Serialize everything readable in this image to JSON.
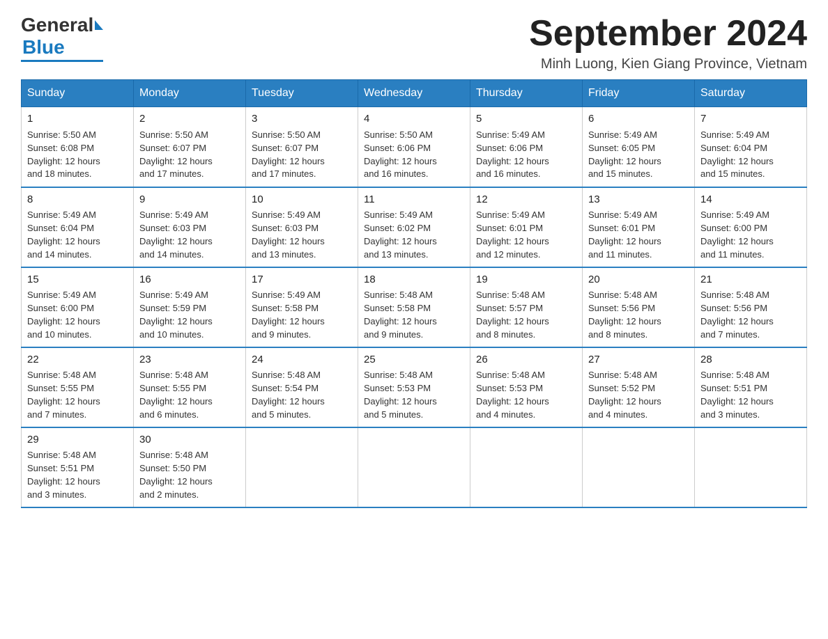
{
  "logo": {
    "general": "General",
    "blue": "Blue"
  },
  "title": {
    "month_year": "September 2024",
    "location": "Minh Luong, Kien Giang Province, Vietnam"
  },
  "days_of_week": [
    "Sunday",
    "Monday",
    "Tuesday",
    "Wednesday",
    "Thursday",
    "Friday",
    "Saturday"
  ],
  "weeks": [
    [
      {
        "day": "1",
        "sunrise": "5:50 AM",
        "sunset": "6:08 PM",
        "daylight": "12 hours and 18 minutes."
      },
      {
        "day": "2",
        "sunrise": "5:50 AM",
        "sunset": "6:07 PM",
        "daylight": "12 hours and 17 minutes."
      },
      {
        "day": "3",
        "sunrise": "5:50 AM",
        "sunset": "6:07 PM",
        "daylight": "12 hours and 17 minutes."
      },
      {
        "day": "4",
        "sunrise": "5:50 AM",
        "sunset": "6:06 PM",
        "daylight": "12 hours and 16 minutes."
      },
      {
        "day": "5",
        "sunrise": "5:49 AM",
        "sunset": "6:06 PM",
        "daylight": "12 hours and 16 minutes."
      },
      {
        "day": "6",
        "sunrise": "5:49 AM",
        "sunset": "6:05 PM",
        "daylight": "12 hours and 15 minutes."
      },
      {
        "day": "7",
        "sunrise": "5:49 AM",
        "sunset": "6:04 PM",
        "daylight": "12 hours and 15 minutes."
      }
    ],
    [
      {
        "day": "8",
        "sunrise": "5:49 AM",
        "sunset": "6:04 PM",
        "daylight": "12 hours and 14 minutes."
      },
      {
        "day": "9",
        "sunrise": "5:49 AM",
        "sunset": "6:03 PM",
        "daylight": "12 hours and 14 minutes."
      },
      {
        "day": "10",
        "sunrise": "5:49 AM",
        "sunset": "6:03 PM",
        "daylight": "12 hours and 13 minutes."
      },
      {
        "day": "11",
        "sunrise": "5:49 AM",
        "sunset": "6:02 PM",
        "daylight": "12 hours and 13 minutes."
      },
      {
        "day": "12",
        "sunrise": "5:49 AM",
        "sunset": "6:01 PM",
        "daylight": "12 hours and 12 minutes."
      },
      {
        "day": "13",
        "sunrise": "5:49 AM",
        "sunset": "6:01 PM",
        "daylight": "12 hours and 11 minutes."
      },
      {
        "day": "14",
        "sunrise": "5:49 AM",
        "sunset": "6:00 PM",
        "daylight": "12 hours and 11 minutes."
      }
    ],
    [
      {
        "day": "15",
        "sunrise": "5:49 AM",
        "sunset": "6:00 PM",
        "daylight": "12 hours and 10 minutes."
      },
      {
        "day": "16",
        "sunrise": "5:49 AM",
        "sunset": "5:59 PM",
        "daylight": "12 hours and 10 minutes."
      },
      {
        "day": "17",
        "sunrise": "5:49 AM",
        "sunset": "5:58 PM",
        "daylight": "12 hours and 9 minutes."
      },
      {
        "day": "18",
        "sunrise": "5:48 AM",
        "sunset": "5:58 PM",
        "daylight": "12 hours and 9 minutes."
      },
      {
        "day": "19",
        "sunrise": "5:48 AM",
        "sunset": "5:57 PM",
        "daylight": "12 hours and 8 minutes."
      },
      {
        "day": "20",
        "sunrise": "5:48 AM",
        "sunset": "5:56 PM",
        "daylight": "12 hours and 8 minutes."
      },
      {
        "day": "21",
        "sunrise": "5:48 AM",
        "sunset": "5:56 PM",
        "daylight": "12 hours and 7 minutes."
      }
    ],
    [
      {
        "day": "22",
        "sunrise": "5:48 AM",
        "sunset": "5:55 PM",
        "daylight": "12 hours and 7 minutes."
      },
      {
        "day": "23",
        "sunrise": "5:48 AM",
        "sunset": "5:55 PM",
        "daylight": "12 hours and 6 minutes."
      },
      {
        "day": "24",
        "sunrise": "5:48 AM",
        "sunset": "5:54 PM",
        "daylight": "12 hours and 5 minutes."
      },
      {
        "day": "25",
        "sunrise": "5:48 AM",
        "sunset": "5:53 PM",
        "daylight": "12 hours and 5 minutes."
      },
      {
        "day": "26",
        "sunrise": "5:48 AM",
        "sunset": "5:53 PM",
        "daylight": "12 hours and 4 minutes."
      },
      {
        "day": "27",
        "sunrise": "5:48 AM",
        "sunset": "5:52 PM",
        "daylight": "12 hours and 4 minutes."
      },
      {
        "day": "28",
        "sunrise": "5:48 AM",
        "sunset": "5:51 PM",
        "daylight": "12 hours and 3 minutes."
      }
    ],
    [
      {
        "day": "29",
        "sunrise": "5:48 AM",
        "sunset": "5:51 PM",
        "daylight": "12 hours and 3 minutes."
      },
      {
        "day": "30",
        "sunrise": "5:48 AM",
        "sunset": "5:50 PM",
        "daylight": "12 hours and 2 minutes."
      },
      null,
      null,
      null,
      null,
      null
    ]
  ],
  "labels": {
    "sunrise_prefix": "Sunrise: ",
    "sunset_prefix": "Sunset: ",
    "daylight_prefix": "Daylight: "
  }
}
